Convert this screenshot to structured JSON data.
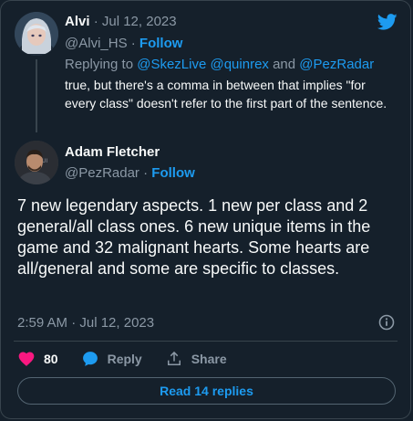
{
  "icons": {
    "brand": "twitter-bird-icon",
    "info": "info-icon",
    "like": "heart-icon",
    "reply": "speech-bubble-icon",
    "share": "share-arrow-icon"
  },
  "colors": {
    "background": "#15202b",
    "accent": "#1d9bf0",
    "like": "#f91880",
    "muted": "#8b98a5",
    "border": "#38444d"
  },
  "reply_tweet": {
    "author_name": "Alvi",
    "date": "Jul 12, 2023",
    "separator": "·",
    "handle": "@Alvi_HS",
    "follow_label": "Follow",
    "replying_prefix": "Replying to",
    "mentions": [
      "@SkezLive",
      "@quinrex",
      "@PezRadar"
    ],
    "and_word": "and",
    "text": "true, but there's a comma in between that implies \"for every class\" doesn't refer to the first part of the sentence."
  },
  "main_tweet": {
    "author_name": "Adam Fletcher",
    "handle": "@PezRadar",
    "separator": "·",
    "follow_label": "Follow",
    "text": "7 new legendary aspects. 1 new per class and 2 general/all class ones. 6 new unique items in the game and 32 malignant hearts.  Some hearts are all/general and some are specific to classes.",
    "timestamp": "2:59 AM · Jul 12, 2023",
    "like_count": "80",
    "reply_label": "Reply",
    "share_label": "Share",
    "read_replies_label": "Read 14 replies"
  }
}
